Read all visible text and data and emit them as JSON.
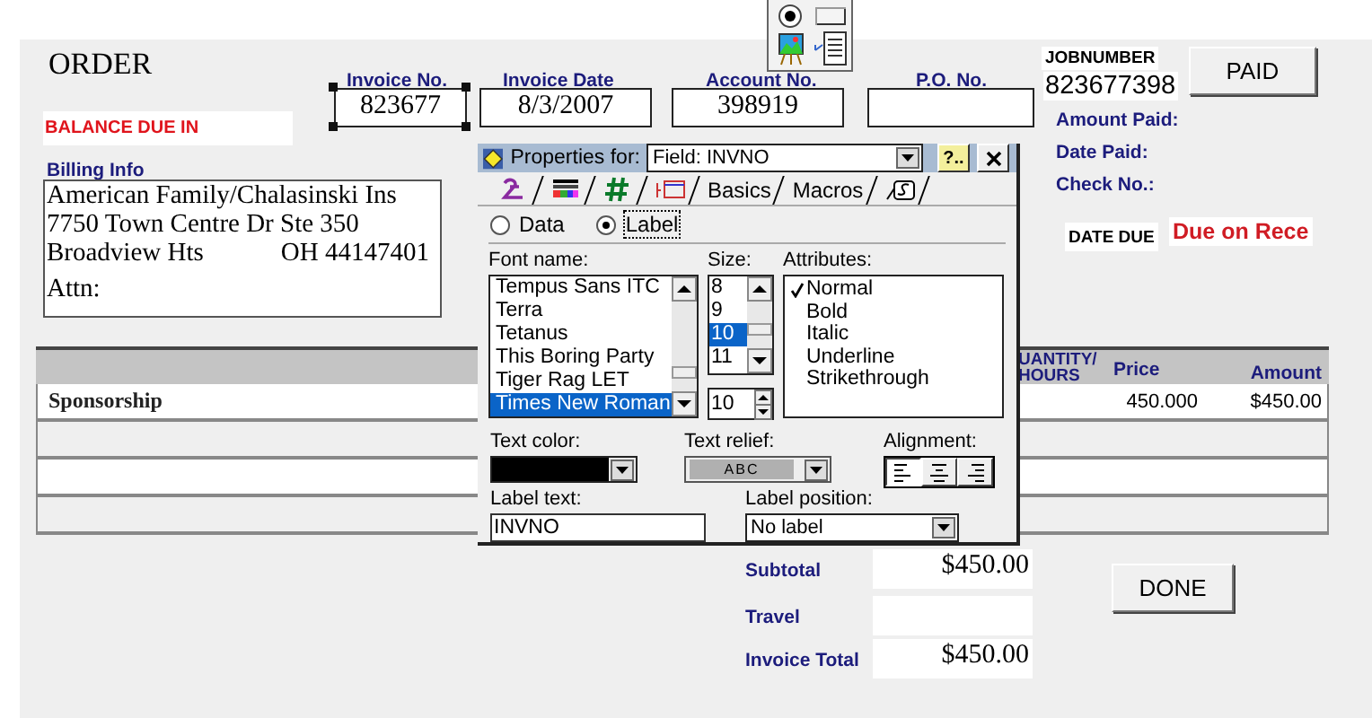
{
  "form": {
    "title": "ORDER",
    "balance_label": "BALANCE DUE IN",
    "billing": {
      "label": "Billing Info",
      "lines": [
        "American Family/Chalasinski Ins",
        "7750 Town Centre Dr Ste 350"
      ],
      "city": "Broadview Hts",
      "state_zip": "OH 44147401",
      "attn": "Attn:"
    },
    "fields": [
      {
        "label": "Invoice No.",
        "value": "823677",
        "selected": true
      },
      {
        "label": "Invoice Date",
        "value": "8/3/2007",
        "selected": false
      },
      {
        "label": "Account No.",
        "value": "398919",
        "selected": false
      },
      {
        "label": "P.O. No.",
        "selected": false
      }
    ],
    "job": {
      "label": "JOBNUMBER",
      "value": "823677398"
    },
    "paid_button": "PAID",
    "payment_labels": [
      "Amount Paid:",
      "Date Paid:",
      "Check No.:"
    ],
    "date_due": {
      "label": "DATE DUE",
      "value": "Due on Rece"
    },
    "table": {
      "columns": [
        "UANTITY/ HOURS",
        "Price",
        "Amount"
      ],
      "rows": [
        {
          "description": "Sponsorship",
          "price": "450.000",
          "amount": "$450.00"
        }
      ]
    },
    "totals": [
      {
        "label": "Subtotal",
        "value": "$450.00"
      },
      {
        "label": "Travel"
      },
      {
        "label": "Invoice Total",
        "value": "$450.00"
      }
    ],
    "done_button": "DONE"
  },
  "palette": {
    "tools": [
      {
        "kind": "radio"
      },
      {
        "kind": "button"
      },
      {
        "kind": "picture"
      },
      {
        "kind": "list"
      }
    ]
  },
  "dialog": {
    "title": "Properties for:",
    "target": "Field: INVNO",
    "help_button": "?..",
    "tabs": [
      {
        "kind": "font"
      },
      {
        "kind": "colors"
      },
      {
        "kind": "number"
      },
      {
        "kind": "border"
      },
      {
        "kind": "text",
        "label": "Basics"
      },
      {
        "kind": "text",
        "label": "Macros"
      },
      {
        "kind": "script"
      }
    ],
    "modes": [
      {
        "label": "Data",
        "selected": false
      },
      {
        "label": "Label",
        "selected": true
      }
    ],
    "font_name": {
      "label": "Font name:",
      "items": [
        {
          "label": "Tempus Sans ITC",
          "selected": false
        },
        {
          "label": "Terra",
          "selected": false
        },
        {
          "label": "Tetanus",
          "selected": false
        },
        {
          "label": "This Boring Party",
          "selected": false
        },
        {
          "label": "Tiger Rag LET",
          "selected": false
        },
        {
          "label": "Times New Roman",
          "selected": true
        }
      ]
    },
    "size": {
      "label": "Size:",
      "items": [
        {
          "label": "8",
          "selected": false
        },
        {
          "label": "9",
          "selected": false
        },
        {
          "label": "10",
          "selected": true
        },
        {
          "label": "11",
          "selected": false
        }
      ],
      "value": "10"
    },
    "attributes": {
      "label": "Attributes:",
      "items": [
        {
          "label": "Normal",
          "checked": true
        },
        {
          "label": "Bold",
          "checked": false
        },
        {
          "label": "Italic",
          "checked": false
        },
        {
          "label": "Underline",
          "checked": false
        },
        {
          "label": "Strikethrough",
          "checked": false
        }
      ]
    },
    "text_color": {
      "label": "Text color:",
      "color": "#000000"
    },
    "text_relief": {
      "label": "Text relief:",
      "sample": "ABC"
    },
    "alignment": {
      "label": "Alignment:",
      "options": [
        {
          "kind": "left",
          "selected": true
        },
        {
          "kind": "center",
          "selected": false
        },
        {
          "kind": "right",
          "selected": false
        }
      ]
    },
    "label_text": {
      "label": "Label text:",
      "value": "INVNO"
    },
    "label_position": {
      "label": "Label position:",
      "value": "No label"
    }
  }
}
